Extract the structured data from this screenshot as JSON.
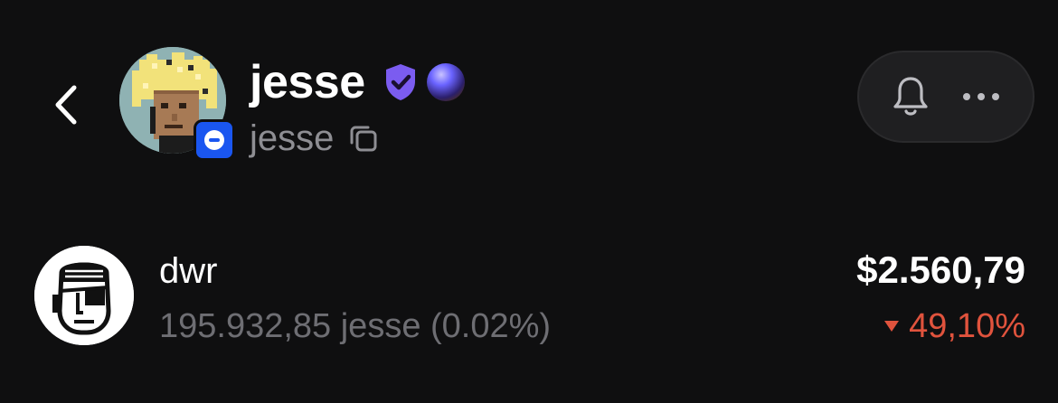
{
  "profile": {
    "display_name": "jesse",
    "handle": "jesse",
    "colors": {
      "verified": "#7b5cf0",
      "avatar_badge": "#1a56f0"
    }
  },
  "icons": {
    "back": "chevron-left-icon",
    "verified": "shield-check-icon",
    "orb": "orb-icon",
    "copy": "copy-icon",
    "notifications": "bell-icon",
    "more": "more-horizontal-icon",
    "change_direction": "triangle-down-icon"
  },
  "token": {
    "name": "dwr",
    "balance": "195.932,85 jesse (0.02%)",
    "value": "$2.560,79",
    "change": "49,10%",
    "colors": {
      "negative": "#e0533d"
    }
  }
}
